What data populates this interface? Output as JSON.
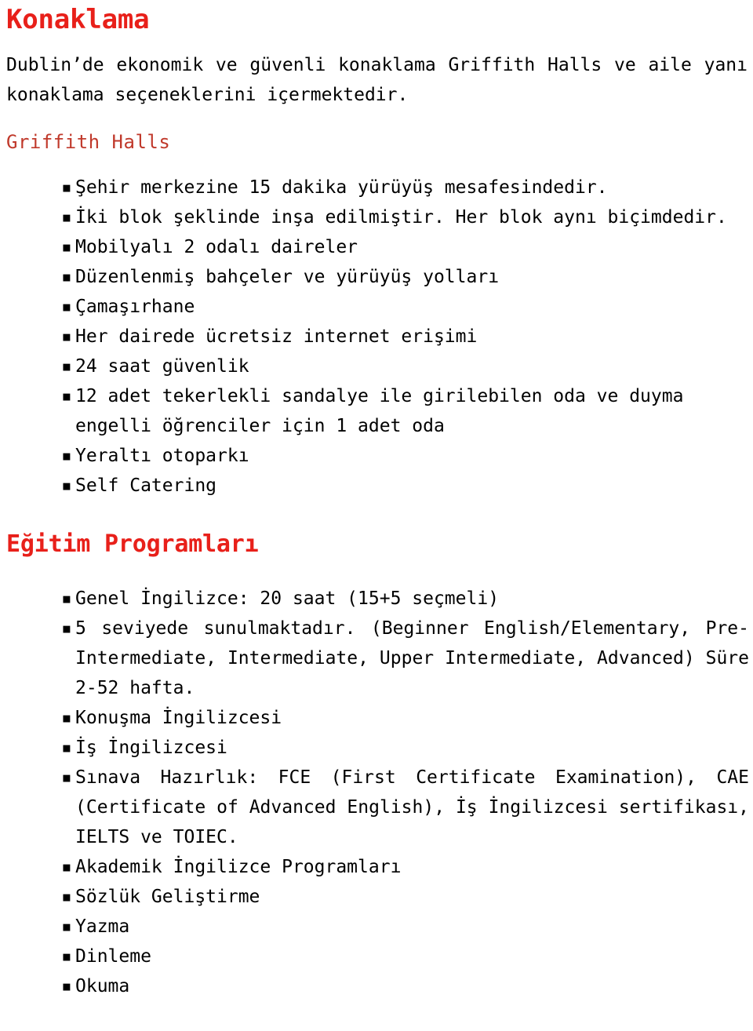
{
  "colors": {
    "heading_primary": "#e8201a",
    "heading_secondary": "#c0392b",
    "body_text": "#000000",
    "background": "#ffffff"
  },
  "icons": {
    "bullet": "▪"
  },
  "document": {
    "title": "Konaklama",
    "intro": "Dublin’de ekonomik ve güvenli konaklama Griffith Halls ve aile yanı konaklama seçeneklerini içermektedir.",
    "sections": [
      {
        "heading": "Griffith Halls",
        "heading_style": "secondary",
        "items": [
          "Şehir merkezine 15 dakika yürüyüş mesafesindedir.",
          "İki blok şeklinde inşa edilmiştir. Her blok aynı biçimdedir.",
          "Mobilyalı 2 odalı daireler",
          "Düzenlenmiş bahçeler ve yürüyüş yolları",
          "Çamaşırhane",
          "Her dairede ücretsiz internet erişimi",
          "24 saat güvenlik",
          "12 adet tekerlekli sandalye ile girilebilen oda ve duyma engelli öğrenciler için 1 adet oda",
          "Yeraltı otoparkı",
          "Self Catering"
        ]
      },
      {
        "heading": "Eğitim Programları",
        "heading_style": "primary",
        "items": [
          "Genel İngilizce: 20 saat (15+5 seçmeli)",
          "5 seviyede sunulmaktadır. (Beginner English/Elementary, Pre-Intermediate, Intermediate, Upper Intermediate, Advanced) Süre 2-52 hafta.",
          "Konuşma İngilizcesi",
          "İş İngilizcesi",
          "Sınava Hazırlık: FCE (First Certificate Examination), CAE (Certificate of Advanced English), İş İngilizcesi sertifikası, IELTS ve TOIEC.",
          "Akademik İngilizce Programları",
          "Sözlük Geliştirme",
          "Yazma",
          "Dinleme",
          "Okuma"
        ]
      }
    ]
  }
}
